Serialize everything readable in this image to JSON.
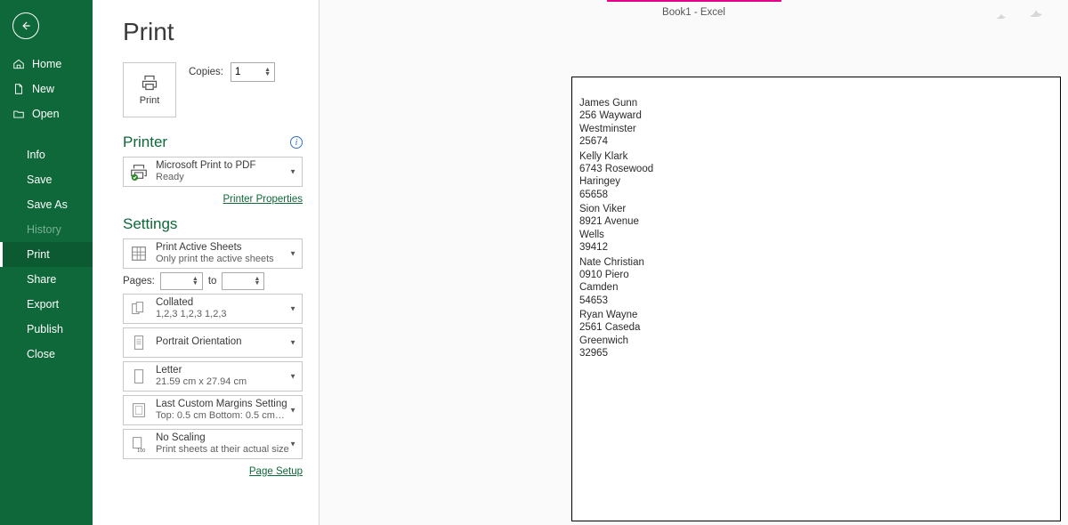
{
  "window_title": "Book1 - Excel",
  "page_heading": "Print",
  "sidebar": {
    "home": "Home",
    "new": "New",
    "open": "Open",
    "info": "Info",
    "save": "Save",
    "save_as": "Save As",
    "history": "History",
    "print": "Print",
    "share": "Share",
    "export": "Export",
    "publish": "Publish",
    "close": "Close"
  },
  "print_button": "Print",
  "copies": {
    "label": "Copies:",
    "value": "1"
  },
  "printer": {
    "heading": "Printer",
    "name": "Microsoft Print to PDF",
    "status": "Ready",
    "properties_link": "Printer Properties"
  },
  "settings": {
    "heading": "Settings",
    "what": {
      "l1": "Print Active Sheets",
      "l2": "Only print the active sheets"
    },
    "pages": {
      "label": "Pages:",
      "to": "to"
    },
    "collate": {
      "l1": "Collated",
      "l2": "1,2,3    1,2,3    1,2,3"
    },
    "orientation": {
      "l1": "Portrait Orientation"
    },
    "paper": {
      "l1": "Letter",
      "l2": "21.59 cm x 27.94 cm"
    },
    "margins": {
      "l1": "Last Custom Margins Setting",
      "l2": "Top: 0.5 cm Bottom: 0.5 cm…"
    },
    "scaling": {
      "l1": "No Scaling",
      "l2": "Print sheets at their actual size"
    },
    "page_setup_link": "Page Setup"
  },
  "preview_records": [
    {
      "name": "James Gunn",
      "street": "256 Wayward",
      "city": "Westminster",
      "zip": "25674"
    },
    {
      "name": "Kelly Klark",
      "street": "6743 Rosewood",
      "city": "Haringey",
      "zip": "65658"
    },
    {
      "name": "Sion Viker",
      "street": "8921 Avenue",
      "city": "Wells",
      "zip": "39412"
    },
    {
      "name": "Nate Christian",
      "street": "0910 Piero",
      "city": "Camden",
      "zip": "54653"
    },
    {
      "name": "Ryan Wayne",
      "street": "2561 Caseda",
      "city": "Greenwich",
      "zip": "32965"
    }
  ]
}
